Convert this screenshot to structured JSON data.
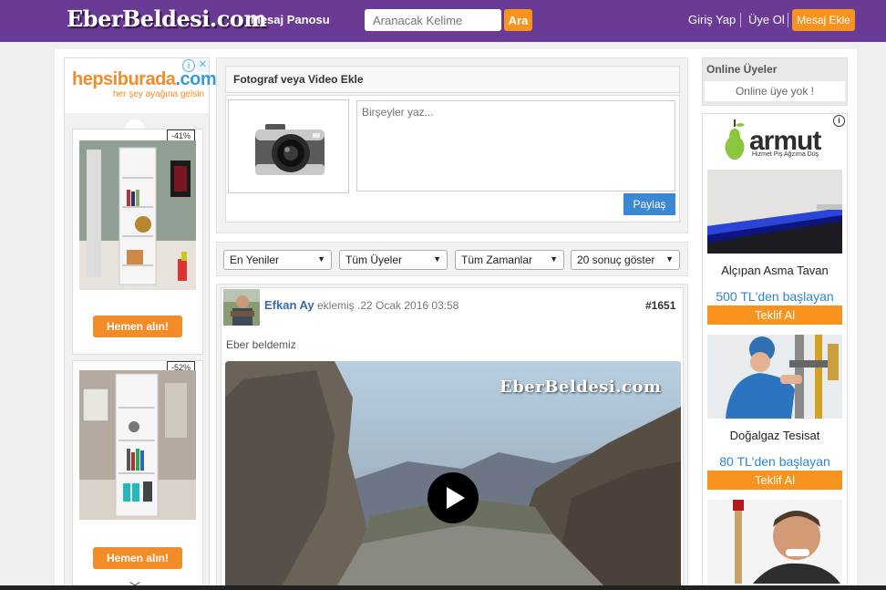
{
  "header": {
    "logo": "EberBeldesi.com",
    "nav_board": "Mesaj Panosu",
    "search_placeholder": "Aranacak Kelime",
    "search_button": "Ara",
    "login": "Giriş Yap",
    "register": "Üye Ol",
    "post_message": "Mesaj Ekle"
  },
  "left_ad": {
    "brand": "hepsiburada",
    "brand_tld": ".com",
    "slogan": "her şey ayağına gelsin",
    "products": [
      {
        "discount": "-41%",
        "button": "Hemen alın!"
      },
      {
        "discount": "-52%",
        "button": "Hemen alın!"
      }
    ]
  },
  "upload": {
    "title": "Fotograf veya Video Ekle",
    "placeholder": "Birşeyler yaz...",
    "share_button": "Paylaş"
  },
  "filters": [
    {
      "label": "En Yeniler"
    },
    {
      "label": "Tüm Üyeler"
    },
    {
      "label": "Tüm Zamanlar"
    },
    {
      "label": "20 sonuç göster"
    }
  ],
  "post": {
    "author": "Efkan Ay",
    "meta": "eklemiş .22 Ocak 2016 03:58",
    "number": "#1651",
    "text": "Eber beldemiz",
    "video_watermark": "EberBeldesi.com"
  },
  "online": {
    "title": "Online Üyeler",
    "empty": "Online üye yok !"
  },
  "right_ad": {
    "brand": "armut",
    "slogan": "Hizmet Piş Ağzıma Düş",
    "services": [
      {
        "title": "Alçıpan Asma Tavan",
        "price": "500 TL'den başlayan",
        "button": "Teklif Al"
      },
      {
        "title": "Doğalgaz Tesisat",
        "price": "80 TL'den başlayan",
        "button": "Teklif Al"
      }
    ]
  }
}
